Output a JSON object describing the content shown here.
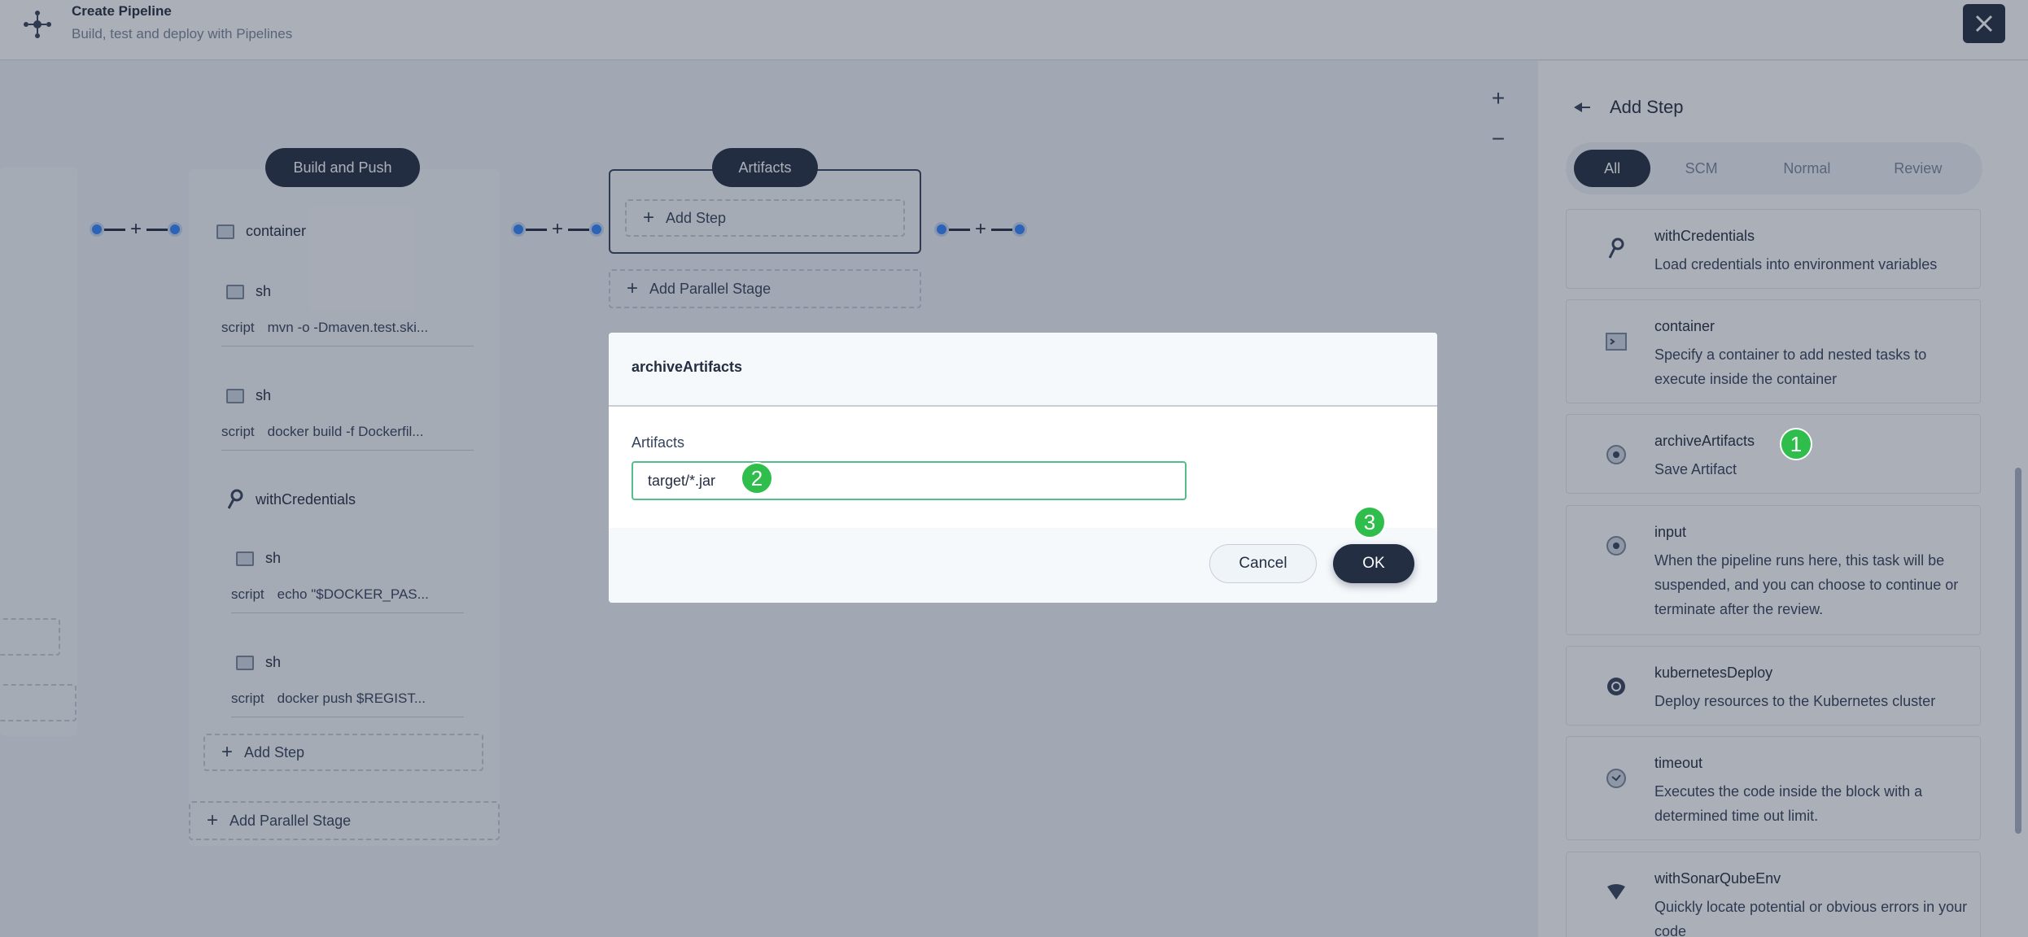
{
  "header": {
    "title": "Create Pipeline",
    "subtitle": "Build, test and deploy with Pipelines"
  },
  "canvas": {
    "zoom_in": "+",
    "zoom_out": "−",
    "stages": [
      {
        "title": "Build and Push",
        "steps": [
          {
            "name": "container"
          },
          {
            "name": "sh",
            "script_key": "script",
            "script_value": "mvn -o -Dmaven.test.ski..."
          },
          {
            "name": "sh",
            "script_key": "script",
            "script_value": "docker build -f Dockerfil..."
          },
          {
            "name": "withCredentials"
          },
          {
            "name": "sh",
            "script_key": "script",
            "script_value": "echo \"$DOCKER_PAS..."
          },
          {
            "name": "sh",
            "script_key": "script",
            "script_value": "docker push $REGIST..."
          }
        ],
        "add_step": "Add Step",
        "add_parallel": "Add Parallel Stage"
      },
      {
        "title": "Artifacts",
        "add_step": "Add Step",
        "add_parallel": "Add Parallel Stage"
      }
    ]
  },
  "panel": {
    "title": "Add Step",
    "tabs": [
      "All",
      "SCM",
      "Normal",
      "Review"
    ],
    "active_tab": "All",
    "cards": [
      {
        "name": "withCredentials",
        "desc": "Load credentials into environment variables",
        "icon": "key-icon"
      },
      {
        "name": "container",
        "desc": "Specify a container to add nested tasks to execute inside the container",
        "icon": "terminal-icon"
      },
      {
        "name": "archiveArtifacts",
        "desc": "Save Artifact",
        "icon": "disc-icon"
      },
      {
        "name": "input",
        "desc": "When the pipeline runs here, this task will be suspended, and you can choose to continue or terminate after the review.",
        "icon": "disc-icon"
      },
      {
        "name": "kubernetesDeploy",
        "desc": "Deploy resources to the Kubernetes cluster",
        "icon": "helm-icon"
      },
      {
        "name": "timeout",
        "desc": "Executes the code inside the block with a determined time out limit.",
        "icon": "clock-icon"
      },
      {
        "name": "withSonarQubeEnv",
        "desc": "Quickly locate potential or obvious errors in your code",
        "icon": "sonar-icon"
      }
    ]
  },
  "modal": {
    "title": "archiveArtifacts",
    "field_label": "Artifacts",
    "field_value": "target/*.jar",
    "cancel": "Cancel",
    "ok": "OK"
  },
  "markers": [
    "1",
    "2",
    "3"
  ],
  "colors": {
    "primary": "#242e42",
    "marker": "#2fbd4b",
    "input_border": "#55bc8a",
    "dot": "#3385ff"
  }
}
